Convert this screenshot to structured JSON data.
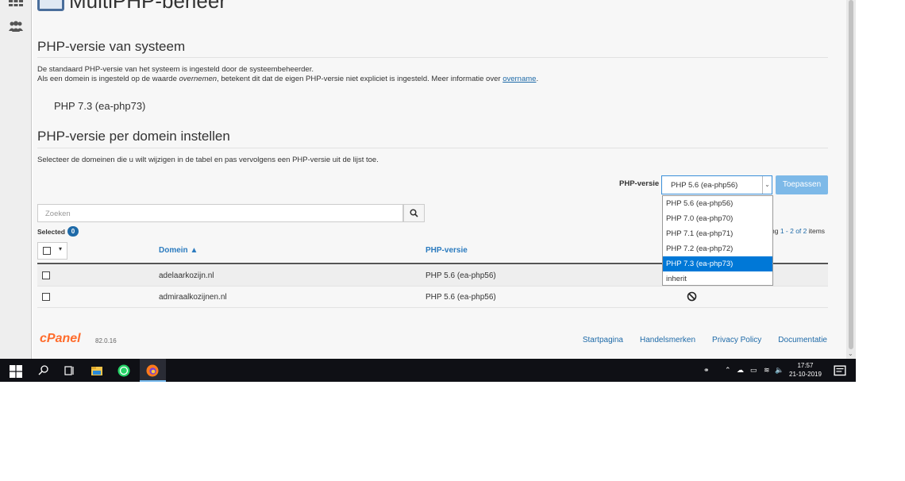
{
  "page": {
    "title": "MultiPHP-beheer",
    "system_section": {
      "heading": "PHP-versie van systeem",
      "line1": "De standaard PHP-versie van het systeem is ingesteld door de systeembeheerder.",
      "line2_prefix": "Als een domein is ingesteld op de waarde ",
      "line2_em": "overnemen",
      "line2_mid": ", betekent dit dat de eigen PHP-versie niet expliciet is ingesteld. Meer informatie over ",
      "line2_link": "overname",
      "line2_suffix": ".",
      "current_version": "PHP 7.3 (ea-php73)"
    },
    "domain_section": {
      "heading": "PHP-versie per domein instellen",
      "instruction": "Selecteer de domeinen die u wilt wijzigen in de tabel en pas vervolgens een PHP-versie uit de lijst toe."
    }
  },
  "php_select": {
    "label": "PHP-versie",
    "value": "PHP 5.6 (ea-php56)",
    "apply_label": "Toepassen",
    "options": [
      {
        "label": "PHP 5.6 (ea-php56)",
        "highlighted": false
      },
      {
        "label": "PHP 7.0 (ea-php70)",
        "highlighted": false
      },
      {
        "label": "PHP 7.1 (ea-php71)",
        "highlighted": false
      },
      {
        "label": "PHP 7.2 (ea-php72)",
        "highlighted": false
      },
      {
        "label": "PHP 7.3 (ea-php73)",
        "highlighted": true
      },
      {
        "label": "inherit",
        "highlighted": false
      }
    ]
  },
  "search": {
    "placeholder": "Zoeken"
  },
  "selection": {
    "label": "Selected",
    "count": "0"
  },
  "paging": {
    "prefix": "ng ",
    "range": "1 - 2 of 2",
    "suffix": " items"
  },
  "table": {
    "headers": {
      "domain": "Domein ▲",
      "php_version": "PHP-versie"
    },
    "rows": [
      {
        "domain": "adelaarkozijn.nl",
        "php_version": "PHP 5.6 (ea-php56)"
      },
      {
        "domain": "admiraalkozijnen.nl",
        "php_version": "PHP 5.6 (ea-php56)"
      }
    ]
  },
  "footer": {
    "logo": "cPanel",
    "version": "82.0.16",
    "links": [
      "Startpagina",
      "Handelsmerken",
      "Privacy Policy",
      "Documentatie"
    ]
  },
  "taskbar": {
    "time": "17:57",
    "date": "21-10-2019",
    "icons": [
      "windows-start-icon",
      "search-icon",
      "task-view-icon",
      "file-explorer-icon",
      "whatsapp-icon",
      "firefox-icon"
    ]
  },
  "colors": {
    "accent": "#1e6aa8",
    "selection_highlight": "#0078d7",
    "cpanel_orange": "#ff6c2c",
    "taskbar": "#0f1015"
  }
}
